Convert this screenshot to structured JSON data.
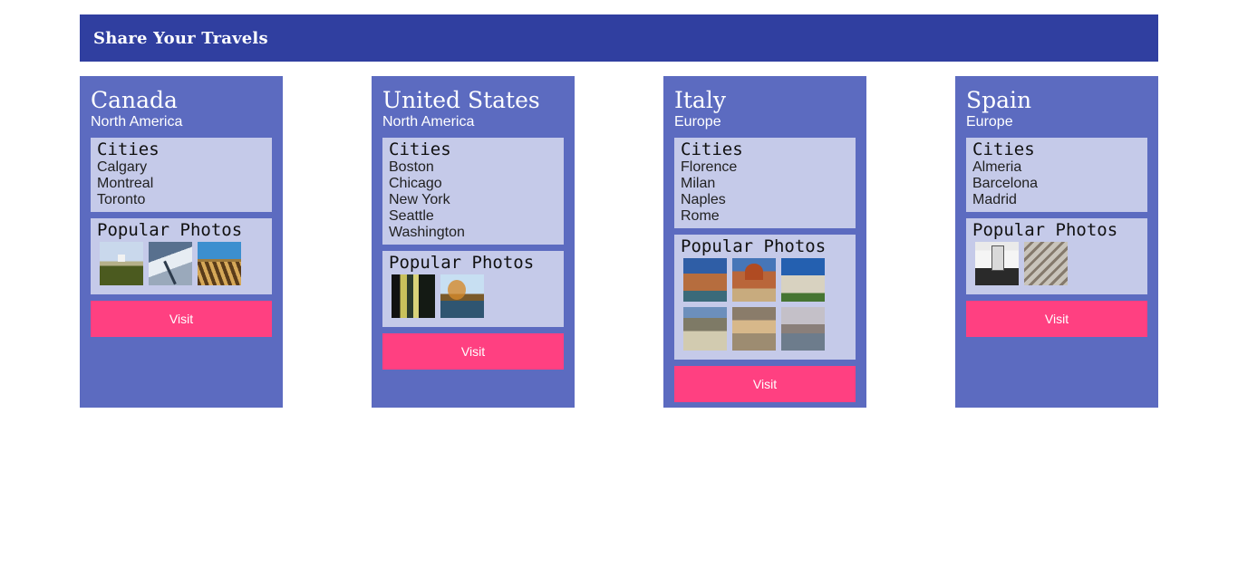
{
  "header": {
    "title": "Share Your Travels"
  },
  "countries": [
    {
      "name": "Canada",
      "continent": "North America",
      "cities_heading": "Cities",
      "cities": [
        "Calgary",
        "Montreal",
        "Toronto"
      ],
      "photos_heading": "Popular Photos",
      "photos": [
        "field-photo",
        "snow-photo",
        "dock-photo"
      ],
      "visit_label": "Visit"
    },
    {
      "name": "United States",
      "continent": "North America",
      "cities_heading": "Cities",
      "cities": [
        "Boston",
        "Chicago",
        "New York",
        "Seattle",
        "Washington"
      ],
      "photos_heading": "Popular Photos",
      "photos": [
        "tower-photo",
        "lake-photo"
      ],
      "visit_label": "Visit"
    },
    {
      "name": "Italy",
      "continent": "Europe",
      "cities_heading": "Cities",
      "cities": [
        "Florence",
        "Milan",
        "Naples",
        "Rome"
      ],
      "photos_heading": "Popular Photos",
      "photos": [
        "venice-photo",
        "duomo-photo",
        "pisa-photo",
        "plaza-photo",
        "rome-photo",
        "canal-photo"
      ],
      "visit_label": "Visit"
    },
    {
      "name": "Spain",
      "continent": "Europe",
      "cities_heading": "Cities",
      "cities": [
        "Almeria",
        "Barcelona",
        "Madrid"
      ],
      "photos_heading": "Popular Photos",
      "photos": [
        "palace-photo",
        "arch-photo"
      ],
      "visit_label": "Visit"
    }
  ],
  "colors": {
    "header_bg": "#303fa0",
    "card_bg": "#5c6bc0",
    "panel_bg": "#c5cae9",
    "visit_bg": "#ff4081"
  }
}
